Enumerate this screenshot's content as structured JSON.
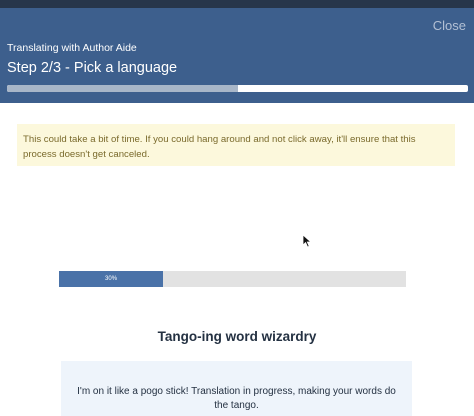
{
  "header": {
    "close_label": "Close",
    "subtitle": "Translating with Author Aide",
    "title": "Step 2/3 - Pick a language",
    "step_progress": 0.5
  },
  "notice": {
    "text": "This could take a bit of time. If you could hang around and not click away, it'll ensure that this process doesn't get canceled."
  },
  "progress": {
    "value": 30,
    "label": "30%"
  },
  "section": {
    "heading": "Tango-ing word wizardry",
    "message": "I'm on it like a pogo stick! Translation in progress, making your words do the tango."
  },
  "colors": {
    "header_bg": "#3d5f8d",
    "accent": "#4a72a8",
    "notice_bg": "#fcf8dc",
    "message_bg": "#eef4fb"
  }
}
